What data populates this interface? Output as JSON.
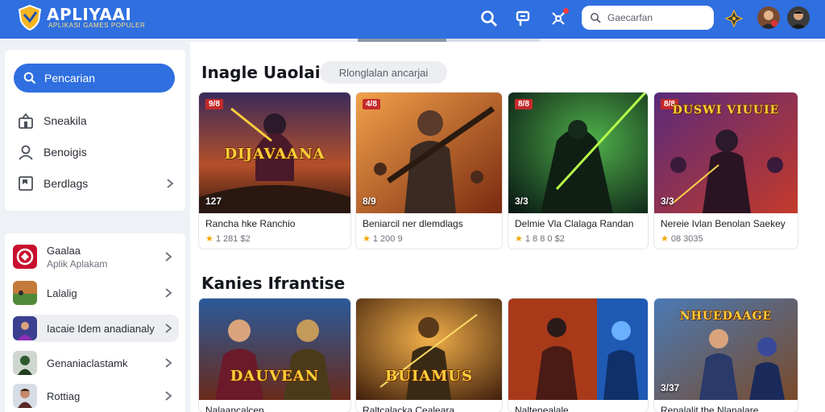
{
  "header": {
    "app_title": "APLIYAAI",
    "app_subtitle": "APLIKASI GAMES POPULER",
    "search_placeholder": "Gaecarfan",
    "accent_color": "#2f6fe0",
    "icons": [
      "search-icon",
      "flag-icon",
      "network-icon",
      "notification-dot",
      "gamepad-icon"
    ]
  },
  "sidebar": {
    "search_label": "Pencarian",
    "nav_items": [
      {
        "label": "Sneakila",
        "icon": "home-icon"
      },
      {
        "label": "Benoigis",
        "icon": "user-icon"
      },
      {
        "label": "Berdlags",
        "icon": "bookmark-icon"
      }
    ],
    "list_items": [
      {
        "label": "Gaalaa",
        "sub": "Aplik Aplakam",
        "icon": "game-thumb-red"
      },
      {
        "label": "Lalalig",
        "sub": "",
        "icon": "game-thumb-field"
      },
      {
        "label": "Iacaie Idem anadianaly",
        "sub": "",
        "icon": "game-thumb-purple"
      },
      {
        "label": "Genaniaclastamk",
        "sub": "",
        "icon": "game-thumb-green"
      },
      {
        "label": "Rottiag",
        "sub": "",
        "icon": "game-thumb-hero"
      }
    ]
  },
  "main": {
    "section1_title": "Inagle Uaolai ·",
    "filter_chip": "Rlonglalan ancarjai",
    "cards_row1": [
      {
        "badge": "9/8",
        "count": "127",
        "art_text": "DIJAVAANA",
        "name": "Rancha hke Ranchio",
        "rating": "1 281 $2"
      },
      {
        "badge": "4/8",
        "count": "8/9",
        "art_text": "",
        "name": "Beniarcil ner dlemdlags",
        "rating": "1 200 9"
      },
      {
        "badge": "8/8",
        "count": "3/3",
        "art_text": "",
        "name": "Delmie Vla Clalaga Randan",
        "rating": "1 8 8 0 $2"
      },
      {
        "badge": "8/8",
        "count": "3/3",
        "art_text": "DUSWI  VIUUIE",
        "name": "Nereie Ivlan Benolan Saekey",
        "rating": "08 3035"
      }
    ],
    "section2_title": "Kanies Ifrantise",
    "cards_row2": [
      {
        "art_text": "DAUVEAN",
        "name": "Nalaancalcen"
      },
      {
        "art_text": "BUIAMUS",
        "name": "Raltcalacka Cealeara"
      },
      {
        "art_text": "",
        "name": "Naltenealale"
      },
      {
        "art_text": "NHUEDAAGE",
        "count": "3/37",
        "name": "Renalalit the Nlanalare"
      }
    ]
  }
}
